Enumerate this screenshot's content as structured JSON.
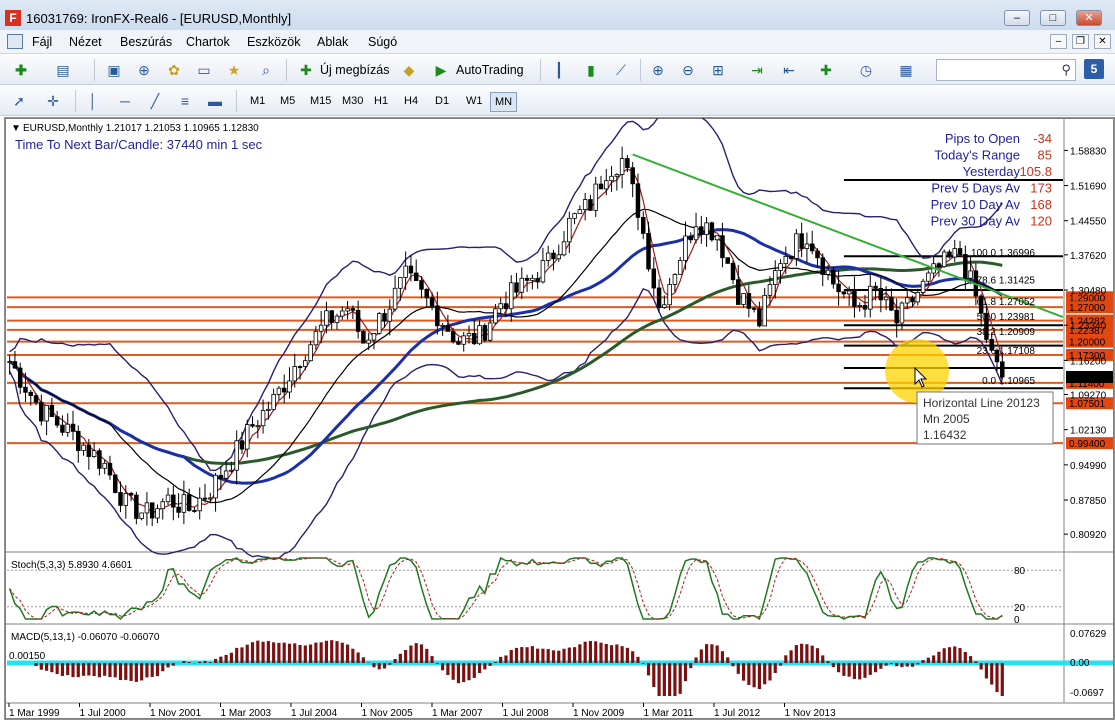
{
  "window": {
    "title": "16031769: IronFX-Real6 - [EURUSD,Monthly]",
    "app_icon": "F",
    "controls": [
      "minimize-icon",
      "maximize-icon",
      "close-icon"
    ]
  },
  "menu": {
    "items": [
      "Fájl",
      "Nézet",
      "Beszúrás",
      "Chartok",
      "Eszközök",
      "Ablak",
      "Súgó"
    ]
  },
  "toolbar1": {
    "new_order_label": "Új megbízás",
    "autotrading_label": "AutoTrading"
  },
  "toolbar2": {
    "timeframes": [
      "M1",
      "M5",
      "M15",
      "M30",
      "H1",
      "H4",
      "D1",
      "W1",
      "MN"
    ],
    "active_timeframe": "MN"
  },
  "search": {
    "badge": "5"
  },
  "chart_data": {
    "type": "candlestick",
    "symbol_header": "EURUSD,Monthly  1.21017 1.21053 1.10965 1.12830",
    "countdown": "Time To Next Bar/Candle: 37440 min 1 sec",
    "info_panel": [
      {
        "label": "Pips to Open",
        "value": "-34"
      },
      {
        "label": "Today's Range",
        "value": "85"
      },
      {
        "label": "Yesterday",
        "value": "105.8"
      },
      {
        "label": "Prev 5 Days Av",
        "value": "173"
      },
      {
        "label": "Prev 10 Day Av",
        "value": "168"
      },
      {
        "label": "Prev 30 Day Av",
        "value": "120"
      }
    ],
    "ylim": [
      0.775,
      1.65
    ],
    "price_ticks": [
      "1.58830",
      "1.51690",
      "1.44550",
      "1.37620",
      "1.30480",
      "1.23340",
      "1.16200",
      "1.09270",
      "1.02130",
      "0.94990",
      "0.87850",
      "0.80920"
    ],
    "price_tick_values": [
      1.5883,
      1.5169,
      1.4455,
      1.3762,
      1.3048,
      1.2334,
      1.162,
      1.0927,
      1.0213,
      0.9499,
      0.8785,
      0.8092
    ],
    "x_labels": [
      "1 Mar 1999",
      "1 Jul 2000",
      "1 Nov 2001",
      "1 Mar 2003",
      "1 Jul 2004",
      "1 Nov 2005",
      "1 Mar 2007",
      "1 Jul 2008",
      "1 Nov 2009",
      "1 Mar 2011",
      "1 Jul 2012",
      "1 Nov 2013"
    ],
    "bar_count": 200,
    "close_path": [
      [
        0,
        1.16
      ],
      [
        6,
        1.06
      ],
      [
        12,
        1.01
      ],
      [
        18,
        0.95
      ],
      [
        22,
        0.87
      ],
      [
        26,
        0.85
      ],
      [
        30,
        0.88
      ],
      [
        34,
        0.86
      ],
      [
        38,
        0.9
      ],
      [
        42,
        0.96
      ],
      [
        46,
        1.03
      ],
      [
        50,
        1.08
      ],
      [
        55,
        1.17
      ],
      [
        60,
        1.24
      ],
      [
        64,
        1.27
      ],
      [
        67,
        1.2
      ],
      [
        71,
        1.26
      ],
      [
        75,
        1.33
      ],
      [
        80,
        1.27
      ],
      [
        85,
        1.2
      ],
      [
        89,
        1.21
      ],
      [
        93,
        1.28
      ],
      [
        97,
        1.31
      ],
      [
        102,
        1.36
      ],
      [
        106,
        1.44
      ],
      [
        110,
        1.48
      ],
      [
        113,
        1.55
      ],
      [
        116,
        1.57
      ],
      [
        119,
        1.47
      ],
      [
        123,
        1.27
      ],
      [
        126,
        1.35
      ],
      [
        130,
        1.45
      ],
      [
        134,
        1.42
      ],
      [
        138,
        1.3
      ],
      [
        142,
        1.24
      ],
      [
        146,
        1.37
      ],
      [
        151,
        1.42
      ],
      [
        156,
        1.32
      ],
      [
        160,
        1.27
      ],
      [
        164,
        1.3
      ],
      [
        168,
        1.24
      ],
      [
        172,
        1.3
      ],
      [
        176,
        1.35
      ],
      [
        180,
        1.38
      ],
      [
        183,
        1.29
      ],
      [
        186,
        1.17
      ],
      [
        188,
        1.12
      ]
    ],
    "fib_levels": [
      {
        "label": "100.0 1.36996",
        "price": 1.36996
      },
      {
        "label": "78.6 1.31425",
        "price": 1.31425
      },
      {
        "label": "61.8 1.27052",
        "price": 1.27052
      },
      {
        "label": "50.0 1.23981",
        "price": 1.23981
      },
      {
        "label": "38.2 1.20909",
        "price": 1.20909
      },
      {
        "label": "23.6 1.17108",
        "price": 1.17108
      },
      {
        "label": "0.0 1.10965",
        "price": 1.10965
      }
    ],
    "horizontal_lines": [
      {
        "price": 1.29,
        "tag": "1.29000"
      },
      {
        "price": 1.27,
        "tag": "1.27000"
      },
      {
        "price": 1.24282,
        "tag": "1.24282"
      },
      {
        "price": 1.22387,
        "tag": "1.22387"
      },
      {
        "price": 1.2,
        "tag": "1.20000"
      },
      {
        "price": 1.173,
        "tag": "1.17300"
      },
      {
        "price": 1.1164,
        "tag": "1.11400"
      },
      {
        "price": 1.07501,
        "tag": "1.07501"
      },
      {
        "price": 0.994,
        "tag": "0.99400"
      }
    ],
    "current_price_tag": "1.12830",
    "current_price": 1.1283,
    "black_levels": [
      1.5283,
      1.3734,
      1.3048,
      1.2334,
      1.1919,
      1.1464,
      1.1055
    ],
    "trendline": {
      "from": [
        118,
        1.58
      ],
      "to": [
        199,
        1.25
      ]
    },
    "tooltip": {
      "lines": [
        "Horizontal Line 20123",
        "Mn 2005",
        "1.16432"
      ]
    },
    "stochastic": {
      "header": "Stoch(5,3,3) 5.8930 4.6601",
      "levels": [
        "80",
        "20",
        "0"
      ],
      "last_values": [
        5.893,
        4.6601
      ]
    },
    "macd": {
      "header": "MACD(5,13,1) -0.06070 -0.06070",
      "ticks": [
        "0.07629",
        "0.00",
        "-0.0697"
      ],
      "left_overlay": "0.00150"
    }
  }
}
